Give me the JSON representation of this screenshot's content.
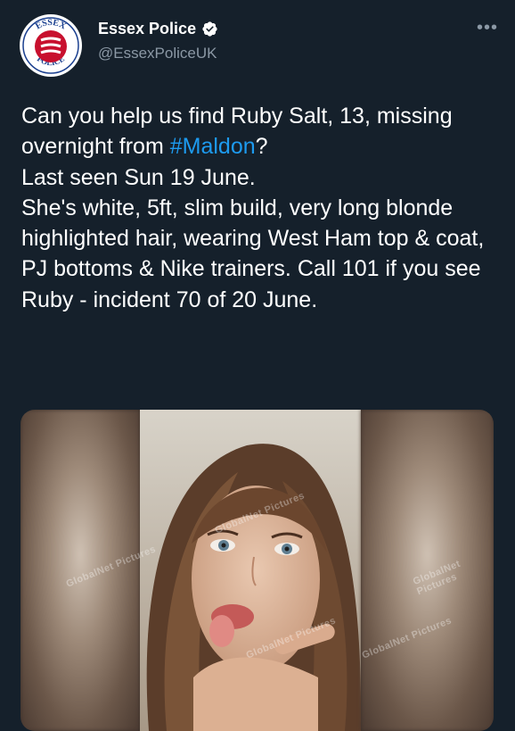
{
  "author": {
    "name": "Essex Police",
    "handle": "@EssexPoliceUK",
    "avatar_top_text": "ESSEX",
    "avatar_bottom_text": "POLICE",
    "verified": true
  },
  "more_icon": "more-horizontal-icon",
  "tweet": {
    "text_before_hashtag": "Can you help us find Ruby Salt, 13, missing overnight from ",
    "hashtag": "#Maldon",
    "text_after_hashtag": "?\nLast seen Sun 19 June.\nShe's white, 5ft, slim build, very long blonde highlighted hair, wearing West Ham top & coat,  PJ bottoms & Nike trainers. Call 101 if you see Ruby - incident 70 of 20 June."
  },
  "media": {
    "watermark": "GlobalNet Pictures"
  },
  "colors": {
    "background": "#15202b",
    "text": "#ffffff",
    "secondary_text": "#8b98a5",
    "link": "#1d9bf0",
    "verified": "#1d9bf0"
  }
}
